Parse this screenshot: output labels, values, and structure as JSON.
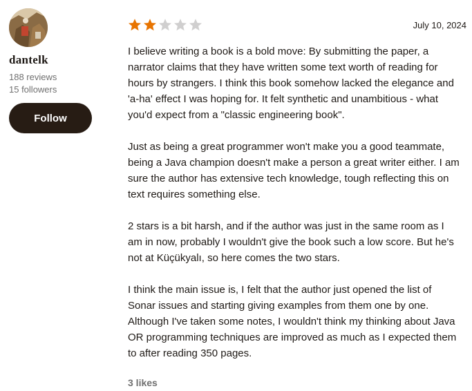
{
  "profile": {
    "avatar_icon": "user-avatar-photo",
    "username": "dantelk",
    "reviews": "188 reviews",
    "followers": "15 followers",
    "follow_label": "Follow"
  },
  "review": {
    "rating": 2,
    "rating_max": 5,
    "star_filled_color": "#e87400",
    "star_empty_color": "#d0cfcf",
    "date": "July 10, 2024",
    "paragraphs": [
      "I believe writing a book is a bold move: By submitting the paper, a narrator claims that they have written some text worth of reading for hours by strangers. I think this book somehow lacked the elegance and 'a-ha' effect I was hoping for. It felt synthetic and unambitious - what you'd expect from a \"classic engineering book\".",
      "Just as being a great programmer won't make you a good teammate, being a Java champion doesn't make a person a great writer either. I am sure the author has extensive tech knowledge, tough reflecting this on text requires something else.",
      "2 stars is a bit harsh, and if the author was just in the same room as I am in now, probably I wouldn't give the book such a low score. But he's not at Küçükyalı, so here comes the two stars.",
      "I think the main issue is, I felt that the author just opened the list of Sonar issues and starting giving examples from them one by one. Although I've taken some notes, I wouldn't think my thinking about Java OR programming techniques are improved as much as I expected them to after reading 350 pages."
    ],
    "likes": "3 likes"
  }
}
